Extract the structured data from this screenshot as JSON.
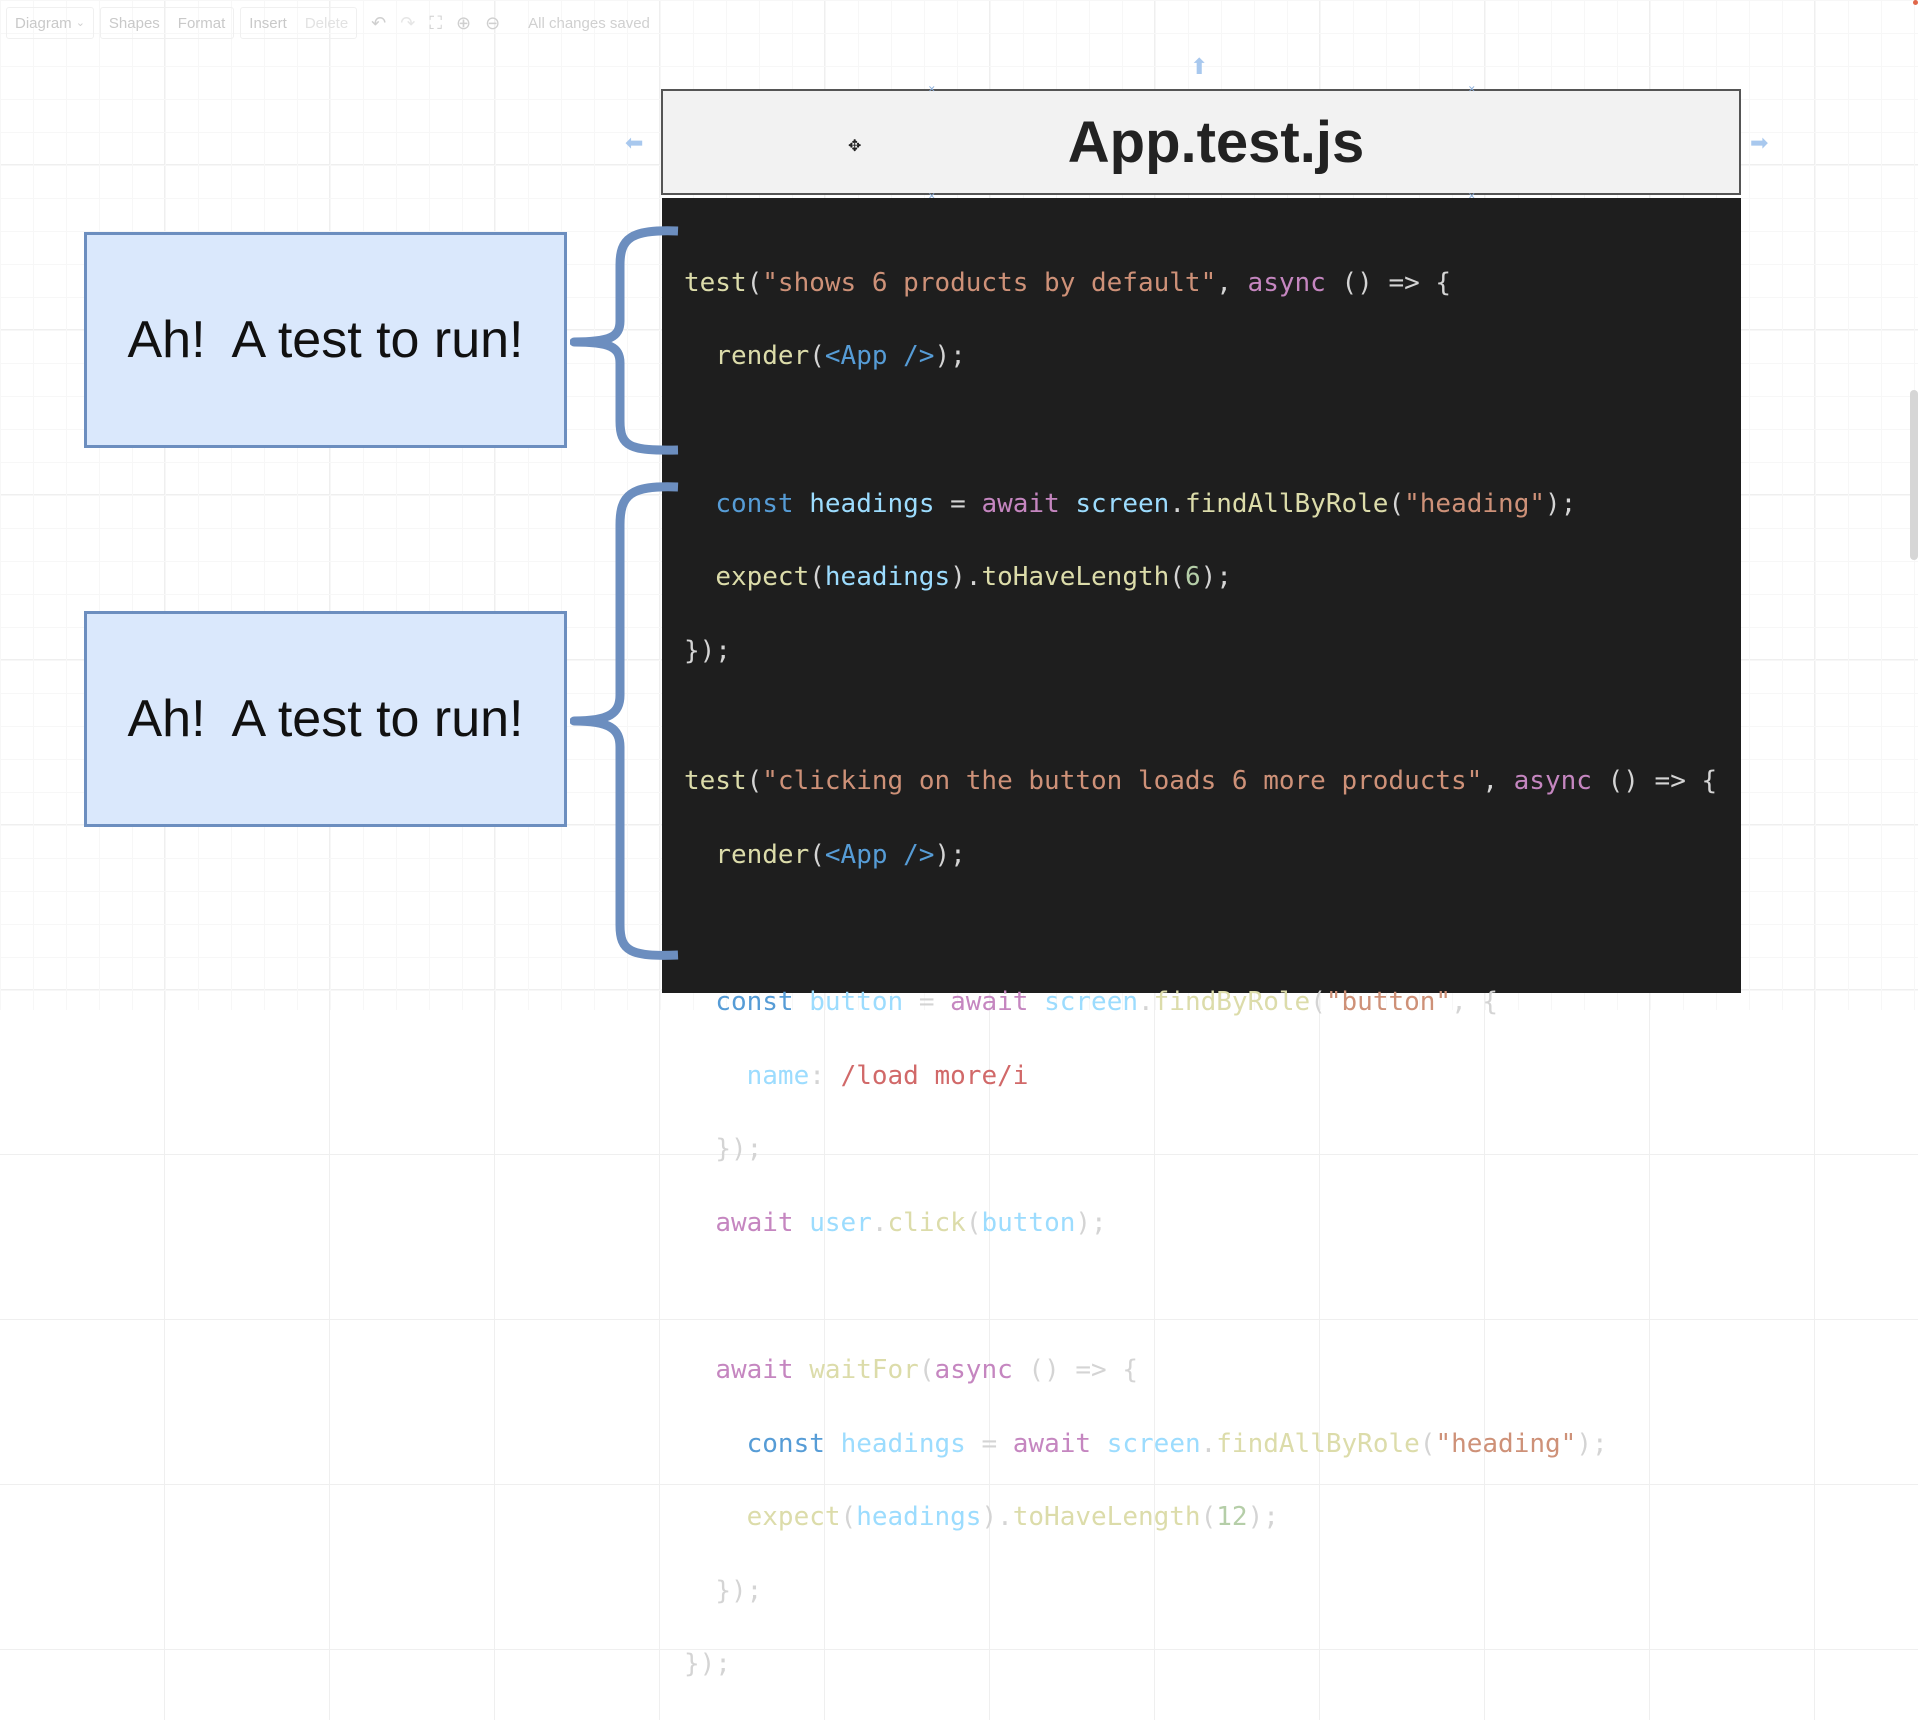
{
  "toolbar": {
    "diagram_menu": "Diagram",
    "shapes": "Shapes",
    "format": "Format",
    "insert": "Insert",
    "delete": "Delete",
    "status": "All changes saved"
  },
  "title_box": {
    "text": "App.test.js"
  },
  "callouts": [
    {
      "text": "Ah!  A test to run!"
    },
    {
      "text": "Ah!  A test to run!"
    }
  ],
  "code": {
    "test1": {
      "l1_fn": "test",
      "l1_str": "\"shows 6 products by default\"",
      "l1_async": "async",
      "l1_rest": " () => {",
      "l2_fn": "render",
      "l2_jsx": "<App />",
      "l4_const": "const",
      "l4_var": "headings",
      "l4_eq": " = ",
      "l4_await": "await",
      "l4_screen": "screen",
      "l4_method": "findAllByRole",
      "l4_str": "\"heading\"",
      "l5_fn": "expect",
      "l5_var": "headings",
      "l5_method": "toHaveLength",
      "l5_num": "6",
      "l6": "});"
    },
    "test2": {
      "l1_fn": "test",
      "l1_str": "\"clicking on the button loads 6 more products\"",
      "l1_async": "async",
      "l1_rest": " () => {",
      "l2_fn": "render",
      "l2_jsx": "<App />",
      "l4_const": "const",
      "l4_var": "button",
      "l4_await": "await",
      "l4_screen": "screen",
      "l4_method": "findByRole",
      "l4_str": "\"button\"",
      "l5_key": "name",
      "l5_reg": "/load more/i",
      "l6": "});",
      "l7_await": "await",
      "l7_var": "user",
      "l7_method": "click",
      "l7_arg": "button",
      "l9_await": "await",
      "l9_fn": "waitFor",
      "l9_async": "async",
      "l9_rest": " () => {",
      "l10_const": "const",
      "l10_var": "headings",
      "l10_await": "await",
      "l10_screen": "screen",
      "l10_method": "findAllByRole",
      "l10_str": "\"heading\"",
      "l11_fn": "expect",
      "l11_var": "headings",
      "l11_method": "toHaveLength",
      "l11_num": "12",
      "l12": "});",
      "l13": "});"
    }
  }
}
